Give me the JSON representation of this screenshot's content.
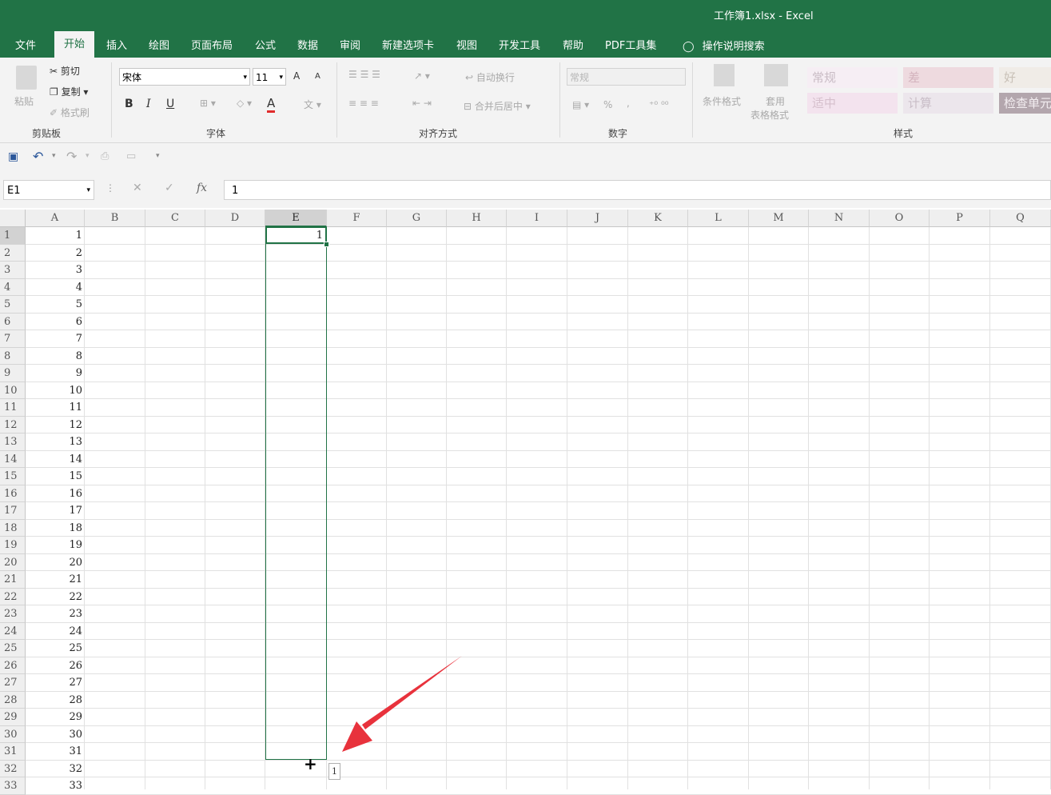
{
  "window": {
    "title": "工作簿1.xlsx  -  Excel"
  },
  "menu": {
    "tabs": [
      "文件",
      "开始",
      "插入",
      "绘图",
      "页面布局",
      "公式",
      "数据",
      "审阅",
      "新建选项卡",
      "视图",
      "开发工具",
      "帮助",
      "PDF工具集"
    ],
    "active": "开始",
    "tell_me": "操作说明搜索"
  },
  "ribbon": {
    "clipboard": {
      "paste": "粘贴",
      "cut": "剪切",
      "copy": "复制",
      "format_painter": "格式刷",
      "label": "剪贴板"
    },
    "font": {
      "name": "宋体",
      "size": "11",
      "bold": "B",
      "italic": "I",
      "underline": "U",
      "font_color": "A",
      "label": "字体",
      "grow": "A",
      "shrink": "A",
      "phonetic": "文"
    },
    "alignment": {
      "wrap": "自动换行",
      "merge": "合并后居中",
      "label": "对齐方式"
    },
    "number": {
      "format": "常规",
      "percent": "%",
      "comma": ",",
      "label": "数字"
    },
    "styles": {
      "conditional": "条件格式",
      "table_line1": "套用",
      "table_line2": "表格格式",
      "cells": [
        "常规",
        "差",
        "好",
        "适中",
        "计算",
        "检查单元"
      ],
      "label": "样式"
    }
  },
  "formula_bar": {
    "name_box": "E1",
    "fx": "fx",
    "cancel": "✕",
    "enter": "✓",
    "value": "1"
  },
  "columns": [
    "A",
    "B",
    "C",
    "D",
    "E",
    "F",
    "G",
    "H",
    "I",
    "J",
    "K",
    "L",
    "M",
    "N",
    "O",
    "P",
    "Q"
  ],
  "selected_column": "E",
  "rows": [
    "1",
    "2",
    "3",
    "4",
    "5",
    "6",
    "7",
    "8",
    "9",
    "10",
    "11",
    "12",
    "13",
    "14",
    "15",
    "16",
    "17",
    "18",
    "19",
    "20",
    "21",
    "22",
    "23",
    "24",
    "25",
    "26",
    "27",
    "28",
    "29",
    "30",
    "31",
    "32",
    "33"
  ],
  "column_a_values": [
    "1",
    "2",
    "3",
    "4",
    "5",
    "6",
    "7",
    "8",
    "9",
    "10",
    "11",
    "12",
    "13",
    "14",
    "15",
    "16",
    "17",
    "18",
    "19",
    "20",
    "21",
    "22",
    "23",
    "24",
    "25",
    "26",
    "27",
    "28",
    "29",
    "30",
    "31",
    "32",
    "33"
  ],
  "cell_e1": "1",
  "fill_tooltip": "1",
  "colors": {
    "accent": "#217346",
    "arrow": "#e8323c"
  }
}
